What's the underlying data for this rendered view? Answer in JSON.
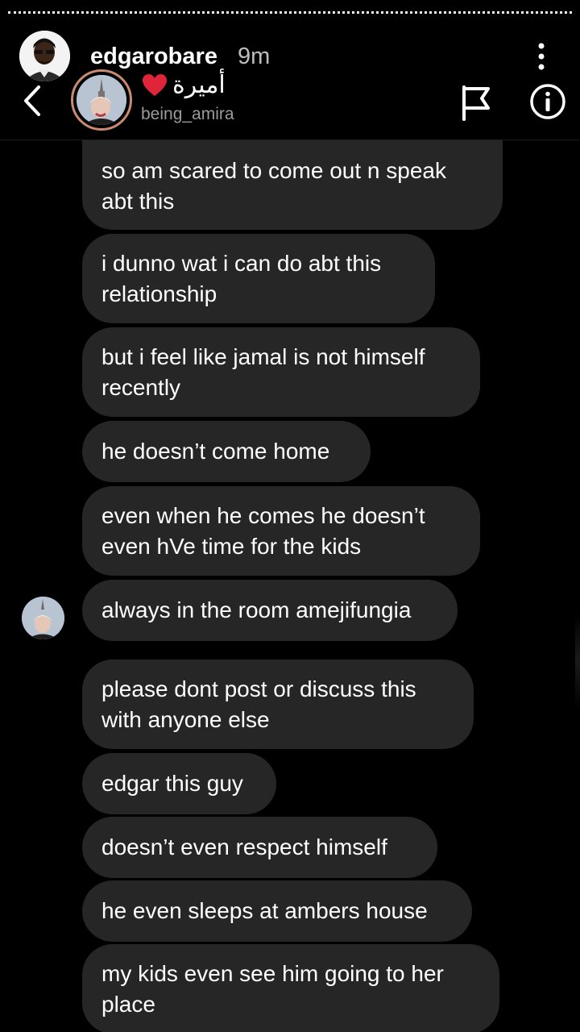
{
  "story": {
    "username": "edgarobare",
    "time": "9m"
  },
  "dm": {
    "display_name": "أميرة",
    "handle": "being_amira"
  },
  "messages": [
    {
      "text": "so am scared to come out n speak abt this"
    },
    {
      "text": "i dunno wat i can do abt this relationship"
    },
    {
      "text": "but i feel like jamal is not himself recently"
    },
    {
      "text": "he doesn’t come home"
    },
    {
      "text": "even when he comes he doesn’t even hVe time for the kids"
    },
    {
      "text": "always in the room amejifungia"
    },
    {
      "text": "please dont post or discuss this with anyone else"
    },
    {
      "text": "edgar this guy"
    },
    {
      "text": "doesn’t even respect himself"
    },
    {
      "text": "he even sleeps at ambers house"
    },
    {
      "text": "my kids even see him going to her place"
    }
  ],
  "colors": {
    "background": "#000000",
    "bubble": "#262626",
    "heart": "#e0243a",
    "avatar_ring": "#c98a6f",
    "secondary_text": "#9a9a9a"
  },
  "icons": [
    "more-icon",
    "back-icon",
    "heart-icon",
    "flag-icon",
    "info-icon"
  ]
}
